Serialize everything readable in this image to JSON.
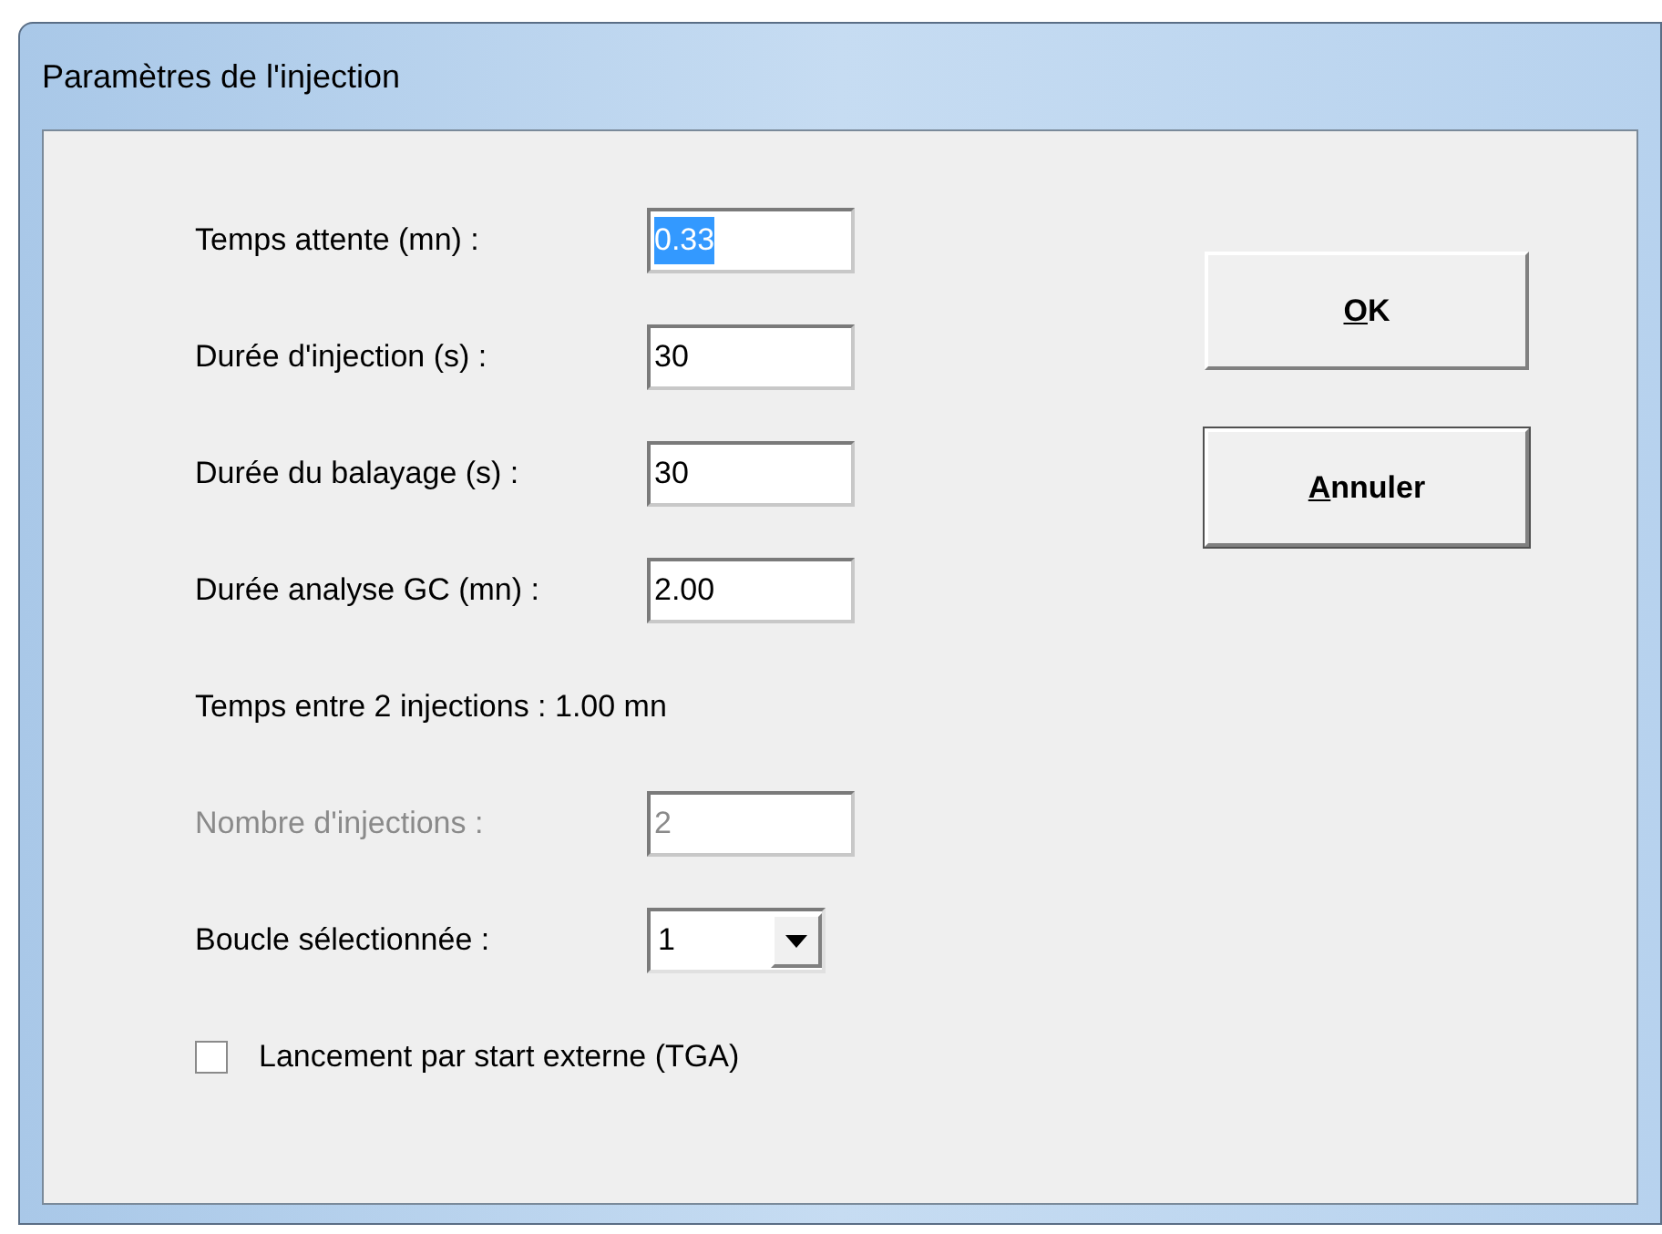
{
  "window": {
    "title": "Paramètres de l'injection"
  },
  "rows": [
    {
      "kind": "field",
      "label": "Temps attente (mn) :",
      "value": "0.33",
      "text_selected": true,
      "disabled": false
    },
    {
      "kind": "field",
      "label": "Durée d'injection (s) :",
      "value": "30",
      "text_selected": false,
      "disabled": false
    },
    {
      "kind": "field",
      "label": "Durée du balayage (s) :",
      "value": "30",
      "text_selected": false,
      "disabled": false
    },
    {
      "kind": "field",
      "label": "Durée analyse GC (mn) :",
      "value": "2.00",
      "text_selected": false,
      "disabled": false
    },
    {
      "kind": "text",
      "label": "Temps entre 2 injections : 1.00 mn"
    },
    {
      "kind": "field",
      "label": "Nombre d'injections :",
      "value": "2",
      "text_selected": false,
      "disabled": true
    },
    {
      "kind": "combo",
      "label": "Boucle sélectionnée :",
      "value": "1"
    },
    {
      "kind": "checkbox",
      "label": "Lancement par start externe (TGA)",
      "checked": false
    }
  ],
  "buttons": [
    {
      "label": "OK",
      "underline_first": true,
      "default": false
    },
    {
      "label": "Annuler",
      "underline_first": true,
      "default": true
    }
  ]
}
